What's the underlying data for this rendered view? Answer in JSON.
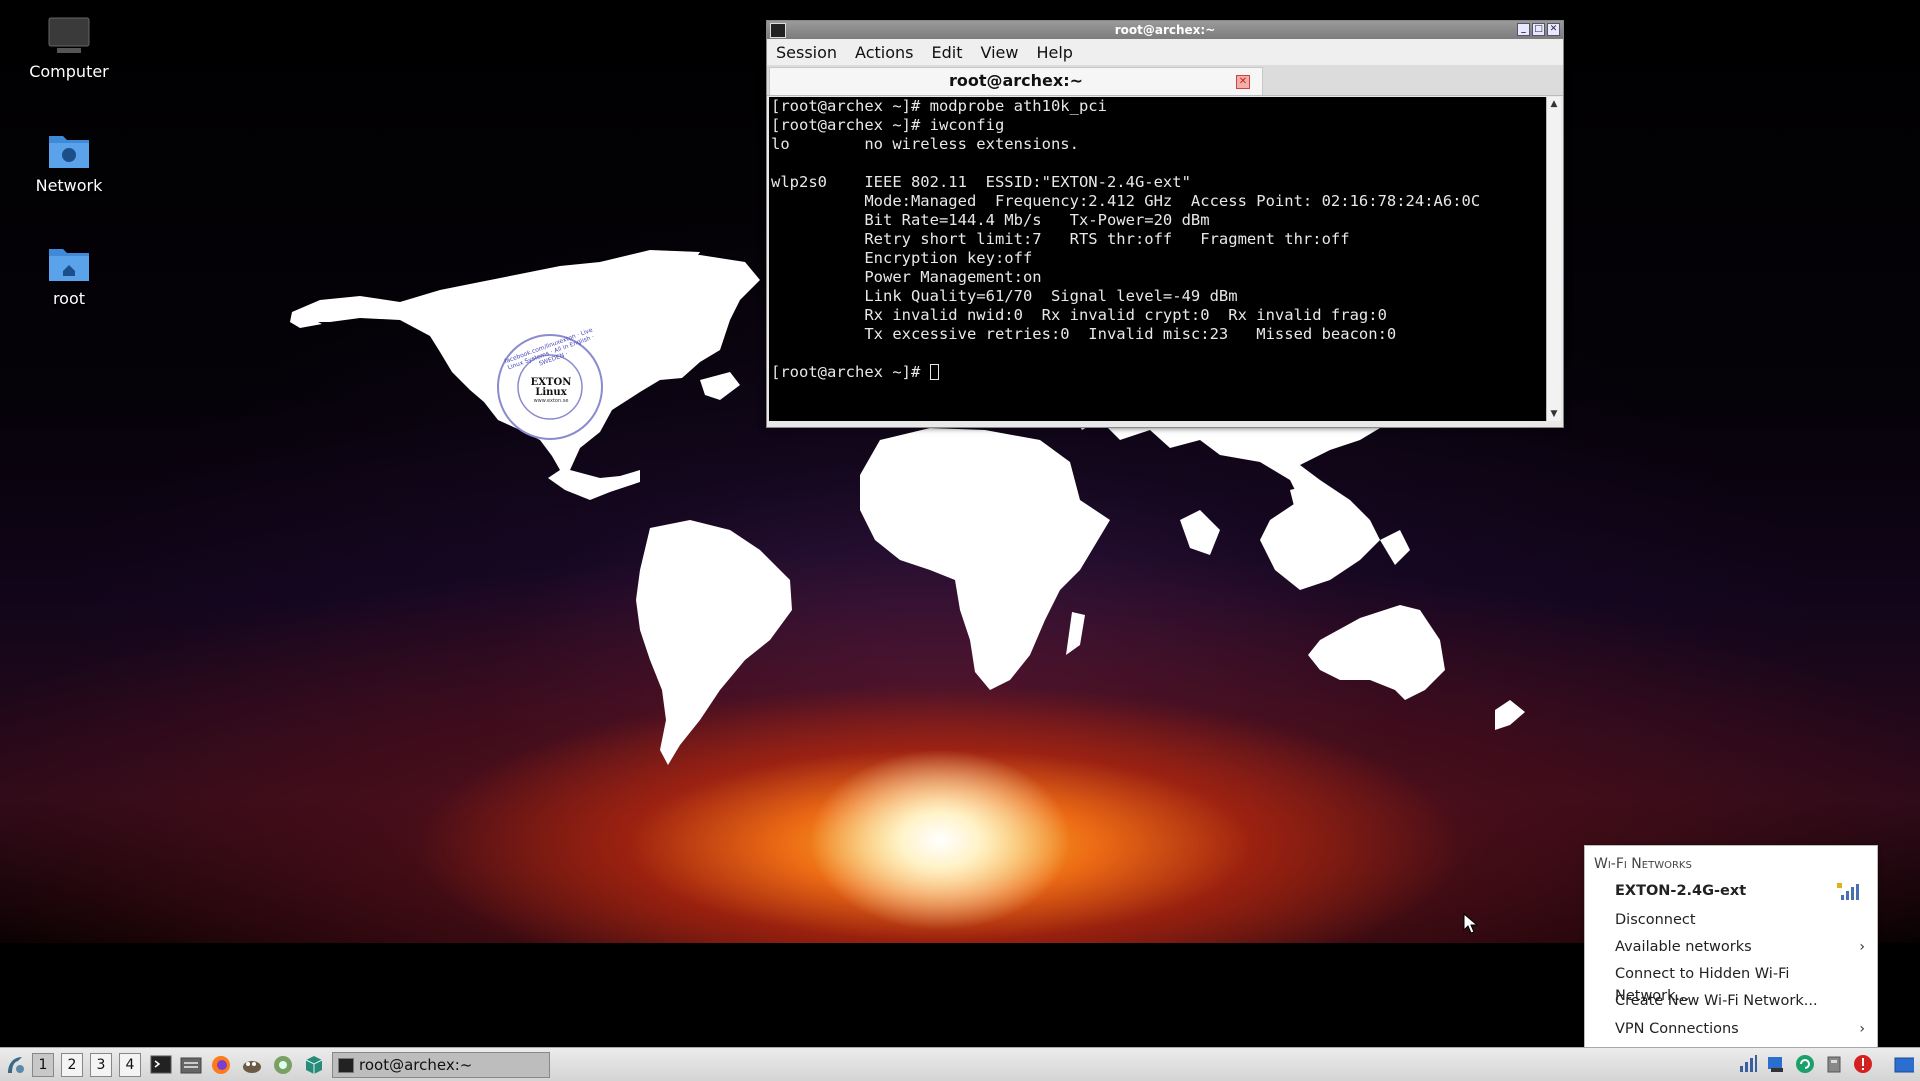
{
  "desktop": {
    "icons": [
      {
        "label": "Computer",
        "icon": "computer-icon"
      },
      {
        "label": "Network",
        "icon": "network-folder-icon"
      },
      {
        "label": "root",
        "icon": "home-folder-icon"
      }
    ],
    "wallpaper_logo": {
      "ring_text": "facebook.com/linuxexton · Live Linux Systems · All in English · SWEDEN ·",
      "center_text": "EXTON Linux",
      "url_text": "www.exton.se"
    }
  },
  "terminal": {
    "window_title": "root@archex:~",
    "menu": [
      "Session",
      "Actions",
      "Edit",
      "View",
      "Help"
    ],
    "tab_label": "root@archex:~",
    "lines": [
      "[root@archex ~]# modprobe ath10k_pci",
      "[root@archex ~]# iwconfig",
      "lo        no wireless extensions.",
      "",
      "wlp2s0    IEEE 802.11  ESSID:\"EXTON-2.4G-ext\"",
      "          Mode:Managed  Frequency:2.412 GHz  Access Point: 02:16:78:24:A6:0C",
      "          Bit Rate=144.4 Mb/s   Tx-Power=20 dBm",
      "          Retry short limit:7   RTS thr:off   Fragment thr:off",
      "          Encryption key:off",
      "          Power Management:on",
      "          Link Quality=61/70  Signal level=-49 dBm",
      "          Rx invalid nwid:0  Rx invalid crypt:0  Rx invalid frag:0",
      "          Tx excessive retries:0  Invalid misc:23   Missed beacon:0",
      ""
    ],
    "prompt": "[root@archex ~]# "
  },
  "wifi_menu": {
    "heading": "Wi-Fi Networks",
    "connected_network": "EXTON-2.4G-ext",
    "items": {
      "disconnect": "Disconnect",
      "available": "Available networks",
      "hidden": "Connect to Hidden Wi-Fi Network...",
      "create": "Create New Wi-Fi Network...",
      "vpn": "VPN Connections"
    }
  },
  "taskbar": {
    "workspaces": [
      "1",
      "2",
      "3",
      "4"
    ],
    "active_workspace": "1",
    "task_button": "root@archex:~",
    "launchers": [
      "menu-icon",
      "terminal-icon",
      "file-manager-icon",
      "firefox-icon",
      "gimp-icon",
      "settings-icon",
      "package-icon"
    ],
    "tray": [
      "network-status-icon",
      "keyboard-icon",
      "update-icon",
      "usb-icon",
      "alert-icon",
      "show-desktop-icon"
    ]
  },
  "colors": {
    "terminal_bg": "#000000",
    "terminal_fg": "#e8e8e8",
    "alert": "#d42020",
    "accent_blue": "#2a6fd0"
  }
}
